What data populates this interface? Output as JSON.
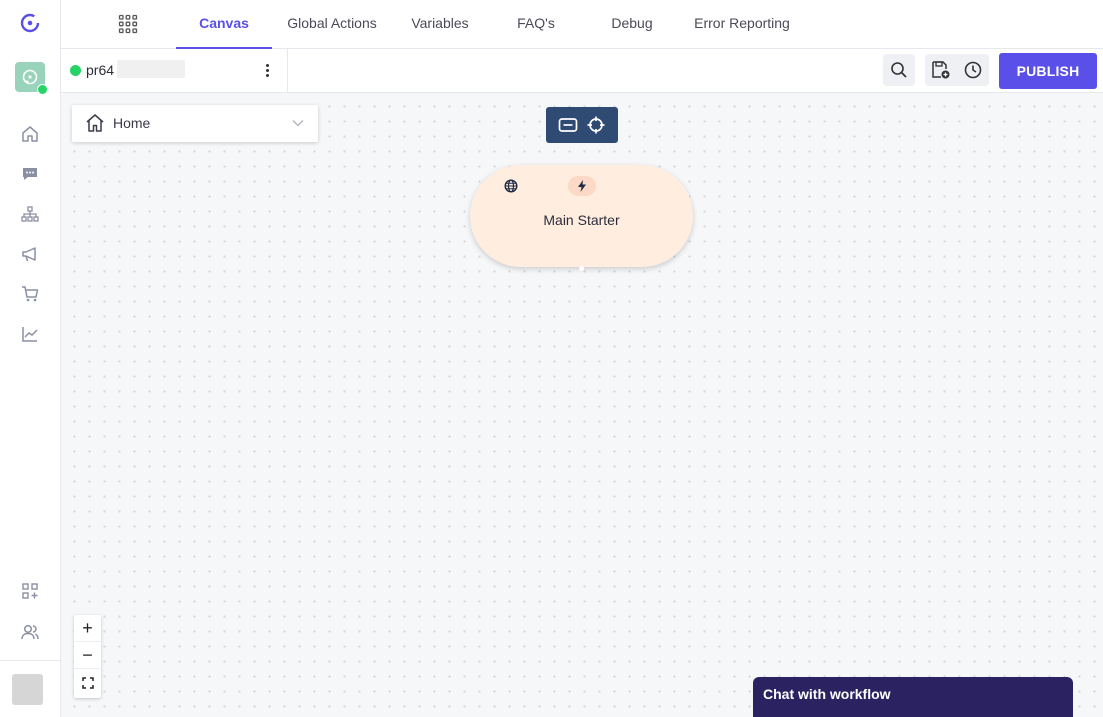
{
  "nav": {
    "tabs": [
      {
        "label": "Canvas",
        "active": true
      },
      {
        "label": "Global Actions"
      },
      {
        "label": "Variables"
      },
      {
        "label": "FAQ's"
      },
      {
        "label": "Debug"
      },
      {
        "label": "Error Reporting"
      }
    ]
  },
  "sidebar": {
    "items": [
      {
        "icon": "home-icon"
      },
      {
        "icon": "chat-icon"
      },
      {
        "icon": "org-tree-icon"
      },
      {
        "icon": "megaphone-icon"
      },
      {
        "icon": "cart-icon"
      },
      {
        "icon": "analytics-icon"
      },
      {
        "icon": "apps-add-icon"
      },
      {
        "icon": "users-icon"
      }
    ]
  },
  "bot": {
    "name": "pr64",
    "channel_icon": "whatsapp-icon"
  },
  "toolbar": {
    "publish_label": "PUBLISH",
    "search_icon": "search-icon",
    "save_icon": "save-icon",
    "history_icon": "history-icon"
  },
  "canvas": {
    "flow_select": "Home",
    "node": {
      "title": "Main Starter",
      "icons": [
        "globe-icon",
        "bolt-icon"
      ]
    },
    "zoom_controls": {
      "zoom_in": "+",
      "zoom_out": "−"
    }
  },
  "chat_widget": {
    "label": "Chat with workflow"
  },
  "colors": {
    "accent": "#5b4fe9",
    "node_bg": "#ffeee0",
    "tool_bg": "#2f4a73",
    "chat_bg": "#2b2262",
    "whatsapp": "#25d366"
  }
}
